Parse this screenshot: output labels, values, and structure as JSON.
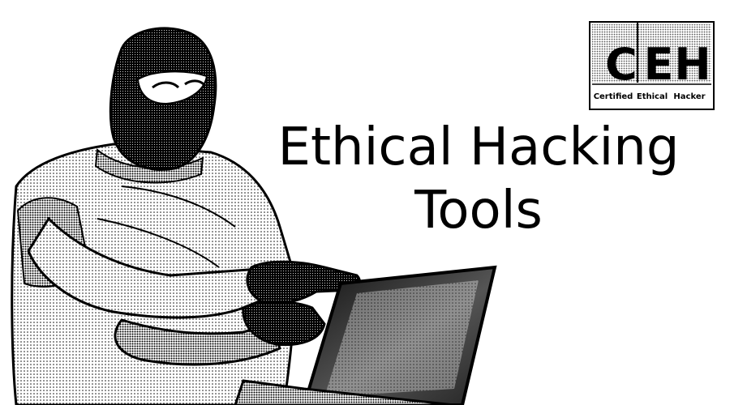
{
  "headline": {
    "line1": "Ethical Hacking",
    "line2": "Tools"
  },
  "logo": {
    "letters": [
      "C",
      "E",
      "H"
    ],
    "words": [
      "Certified",
      "Ethical",
      "Hacker"
    ]
  },
  "illustration": {
    "subject": "masked-hacker-with-laptop-icon"
  },
  "colors": {
    "ink": "#000000",
    "paper": "#ffffff",
    "halftone": "#5a5a5a"
  }
}
